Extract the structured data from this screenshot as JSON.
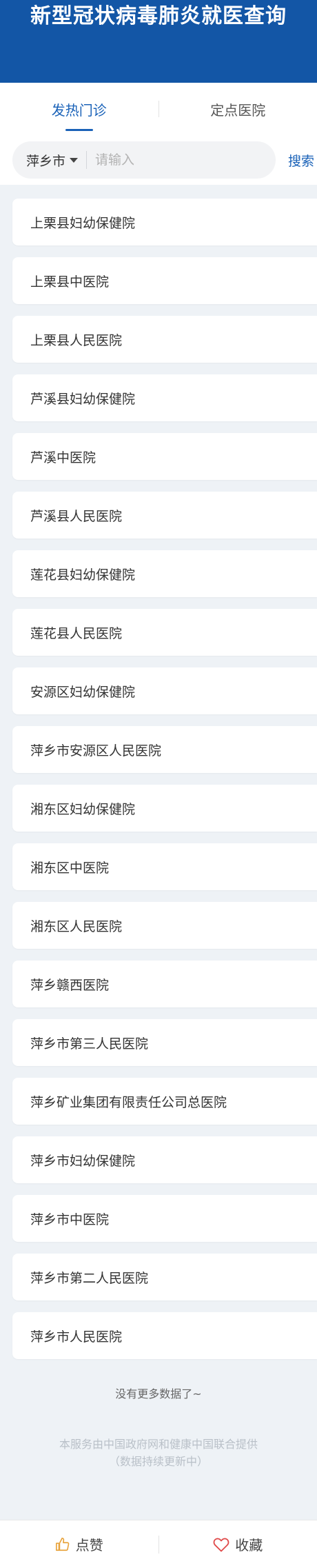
{
  "header": {
    "title": "新型冠状病毒肺炎就医查询"
  },
  "tabs": [
    {
      "label": "发热门诊",
      "active": true
    },
    {
      "label": "定点医院",
      "active": false
    }
  ],
  "search": {
    "city": "萍乡市",
    "placeholder": "请输入",
    "value": "",
    "button_label": "搜索"
  },
  "hospitals": [
    "上栗县妇幼保健院",
    "上栗县中医院",
    "上栗县人民医院",
    "芦溪县妇幼保健院",
    "芦溪中医院",
    "芦溪县人民医院",
    "莲花县妇幼保健院",
    "莲花县人民医院",
    "安源区妇幼保健院",
    "萍乡市安源区人民医院",
    "湘东区妇幼保健院",
    "湘东区中医院",
    "湘东区人民医院",
    "萍乡赣西医院",
    "萍乡市第三人民医院",
    "萍乡矿业集团有限责任公司总医院",
    "萍乡市妇幼保健院",
    "萍乡市中医院",
    "萍乡市第二人民医院",
    "萍乡市人民医院"
  ],
  "list_end_text": "没有更多数据了~",
  "footer": {
    "line1": "本服务由中国政府网和健康中国联合提供",
    "line2": "（数据持续更新中）"
  },
  "bottom_bar": {
    "like_label": "点赞",
    "like_icon": "thumbs-up-icon",
    "favorite_label": "收藏",
    "favorite_icon": "heart-icon"
  },
  "colors": {
    "header_bg": "#1356a6",
    "accent": "#1a62b8",
    "like_icon": "#e8a33c",
    "favorite_icon": "#e04a4a",
    "page_bg": "#eef2f6"
  }
}
